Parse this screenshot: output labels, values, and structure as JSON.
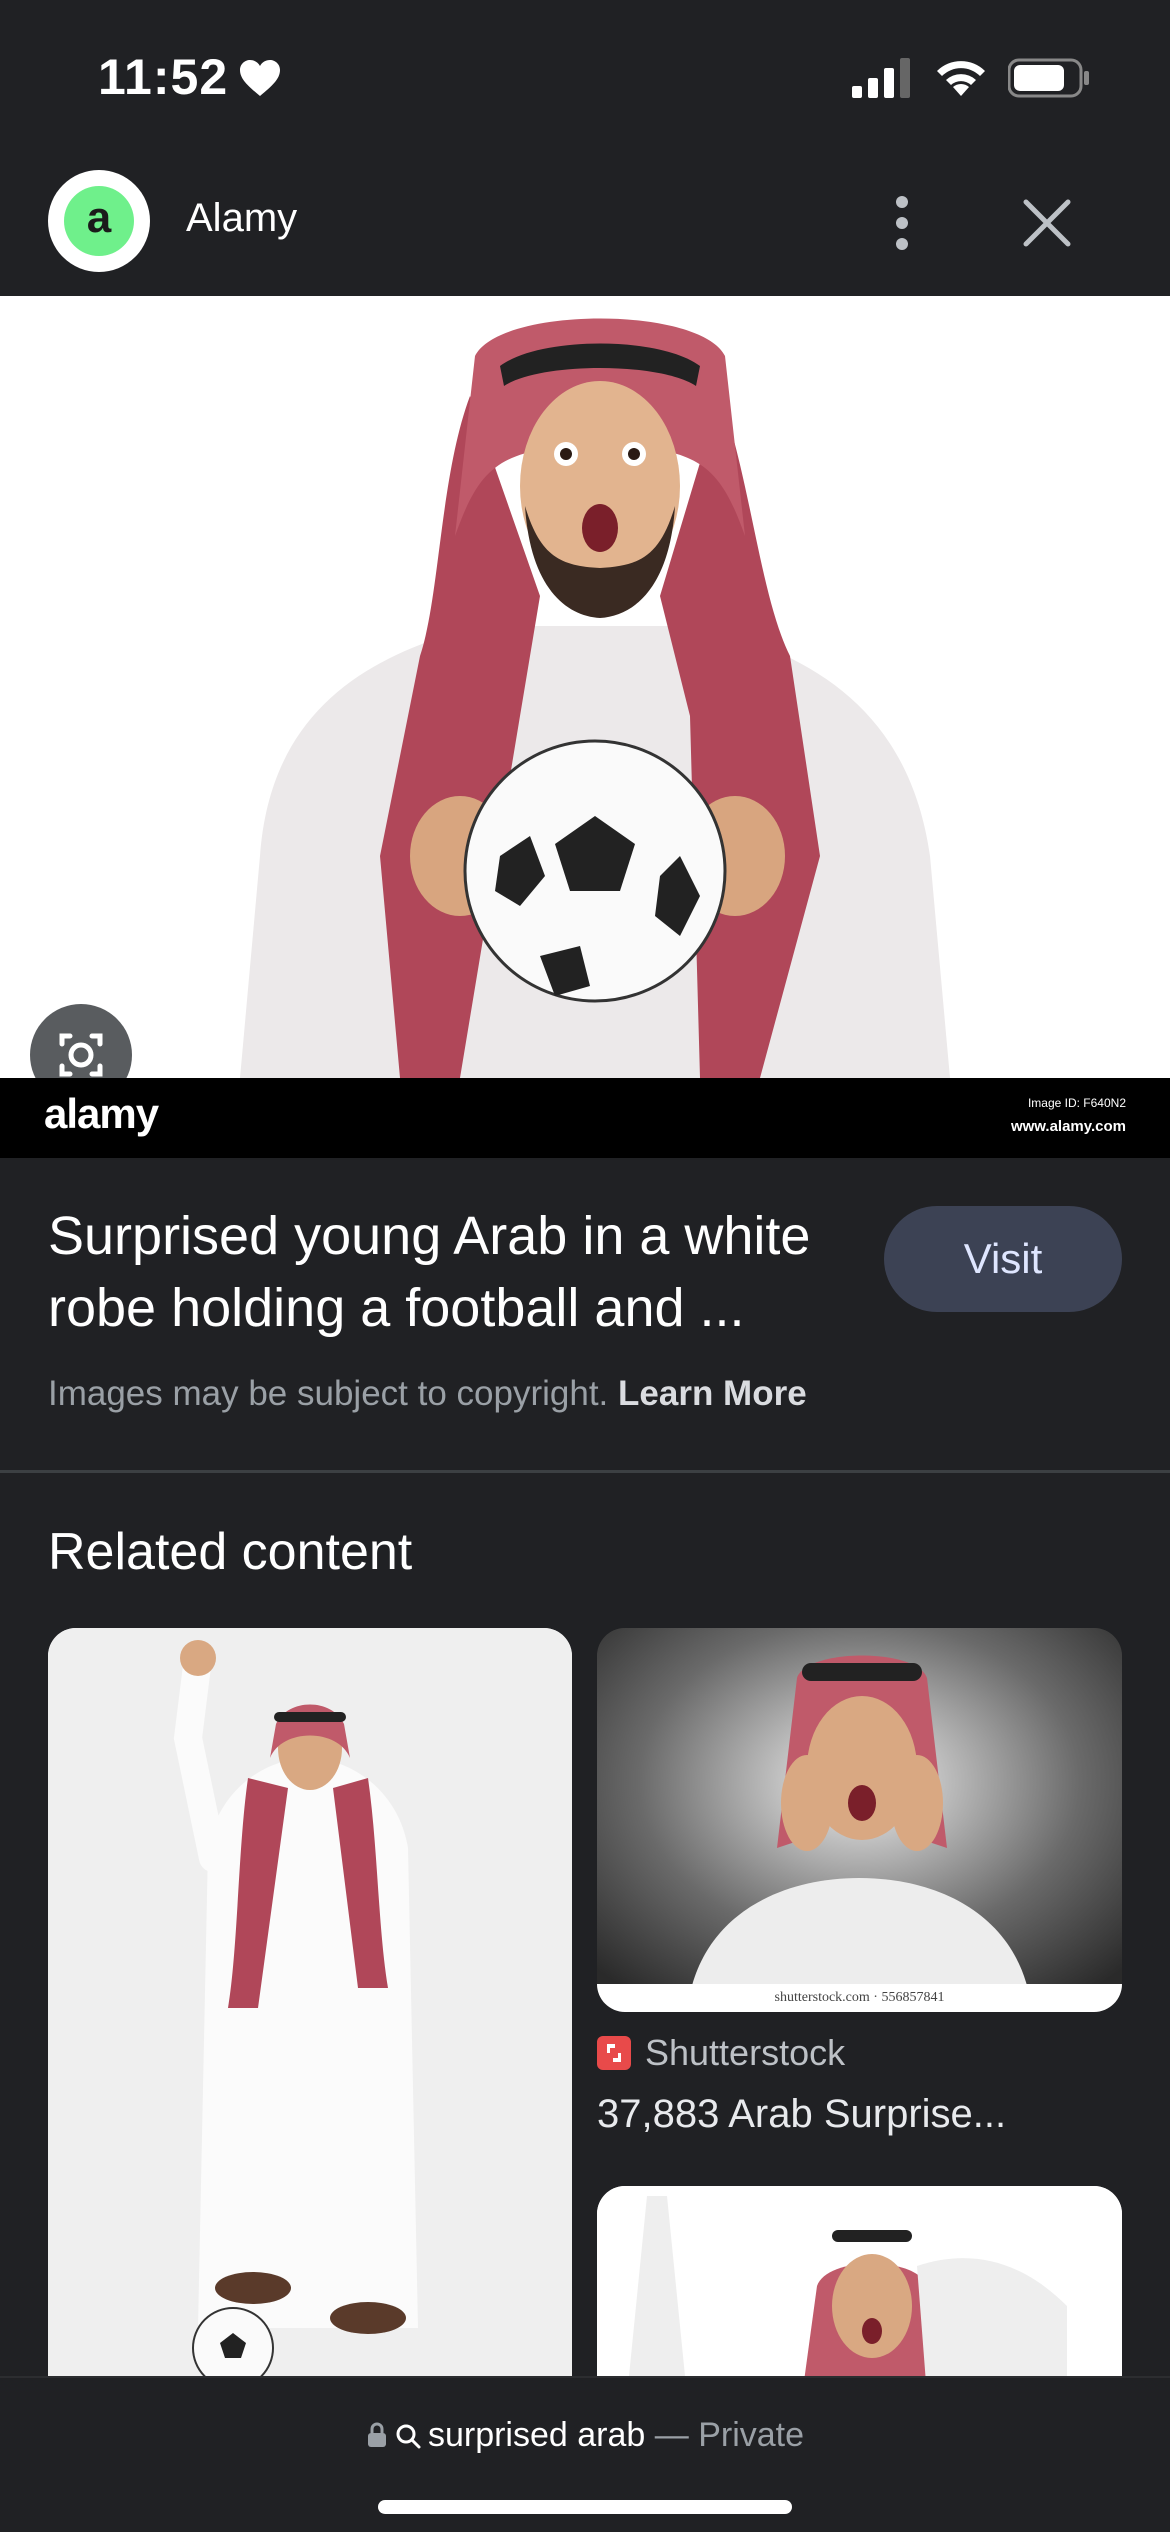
{
  "status_bar": {
    "time": "11:52"
  },
  "header": {
    "site_initial": "a",
    "site_name": "Alamy"
  },
  "image": {
    "watermark_logo": "alamy",
    "image_id": "Image ID: F640N2",
    "url": "www.alamy.com"
  },
  "result": {
    "title": "Surprised young Arab in a white robe holding a football and ...",
    "visit_label": "Visit",
    "copyright_text": "Images may be subject to copyright.",
    "learn_more": "Learn More"
  },
  "related": {
    "heading": "Related content",
    "cards": [
      {
        "source": "Shutterstock",
        "title": "37,883 Arab Surprise...",
        "caption": "shutterstock.com · 556857841"
      }
    ]
  },
  "bottom_bar": {
    "query": "surprised arab",
    "mode": "— Private"
  },
  "colors": {
    "background": "#202124",
    "visit_button": "#3c4254",
    "avatar_green": "#6ff08b"
  }
}
